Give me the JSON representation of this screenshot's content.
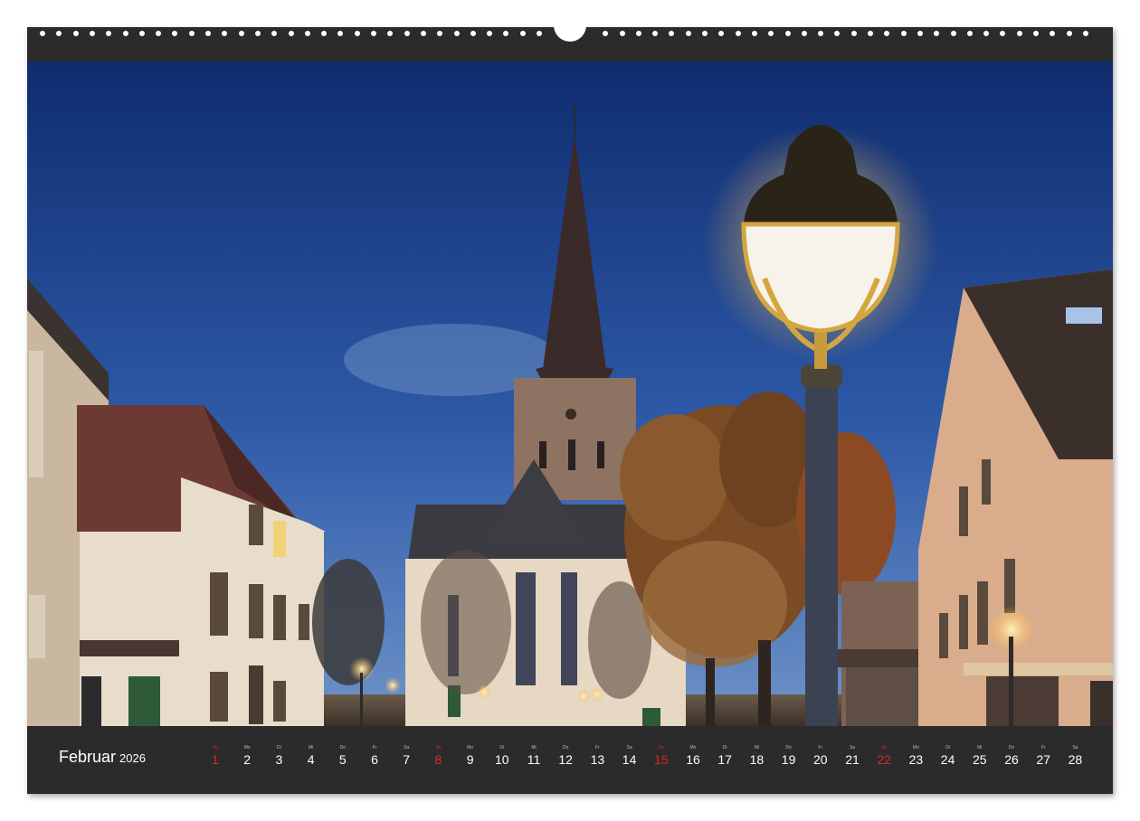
{
  "calendar": {
    "month": "Februar",
    "year": "2026",
    "days": [
      {
        "wd": "So",
        "num": "1",
        "sunday": true
      },
      {
        "wd": "Mo",
        "num": "2",
        "sunday": false
      },
      {
        "wd": "Di",
        "num": "3",
        "sunday": false
      },
      {
        "wd": "Mi",
        "num": "4",
        "sunday": false
      },
      {
        "wd": "Do",
        "num": "5",
        "sunday": false
      },
      {
        "wd": "Fr",
        "num": "6",
        "sunday": false
      },
      {
        "wd": "Sa",
        "num": "7",
        "sunday": false
      },
      {
        "wd": "So",
        "num": "8",
        "sunday": true
      },
      {
        "wd": "Mo",
        "num": "9",
        "sunday": false
      },
      {
        "wd": "Di",
        "num": "10",
        "sunday": false
      },
      {
        "wd": "Mi",
        "num": "11",
        "sunday": false
      },
      {
        "wd": "Do",
        "num": "12",
        "sunday": false
      },
      {
        "wd": "Fr",
        "num": "13",
        "sunday": false
      },
      {
        "wd": "Sa",
        "num": "14",
        "sunday": false
      },
      {
        "wd": "So",
        "num": "15",
        "sunday": true
      },
      {
        "wd": "Mo",
        "num": "16",
        "sunday": false
      },
      {
        "wd": "Di",
        "num": "17",
        "sunday": false
      },
      {
        "wd": "Mi",
        "num": "18",
        "sunday": false
      },
      {
        "wd": "Do",
        "num": "19",
        "sunday": false
      },
      {
        "wd": "Fr",
        "num": "20",
        "sunday": false
      },
      {
        "wd": "Sa",
        "num": "21",
        "sunday": false
      },
      {
        "wd": "So",
        "num": "22",
        "sunday": true
      },
      {
        "wd": "Mo",
        "num": "23",
        "sunday": false
      },
      {
        "wd": "Di",
        "num": "24",
        "sunday": false
      },
      {
        "wd": "Mi",
        "num": "25",
        "sunday": false
      },
      {
        "wd": "Do",
        "num": "26",
        "sunday": false
      },
      {
        "wd": "Fr",
        "num": "27",
        "sunday": false
      },
      {
        "wd": "Sa",
        "num": "28",
        "sunday": false
      }
    ]
  },
  "colors": {
    "frame": "#2b2b2b",
    "sunday": "#e0262a",
    "sky_top": "#0f2c6e",
    "sky_bottom": "#5f86c4",
    "lamp_glow": "#ffd86a"
  },
  "photo": {
    "subject_icons": [
      "church-icon",
      "street-lamp-icon",
      "autumn-tree-icon",
      "house-icon"
    ]
  }
}
